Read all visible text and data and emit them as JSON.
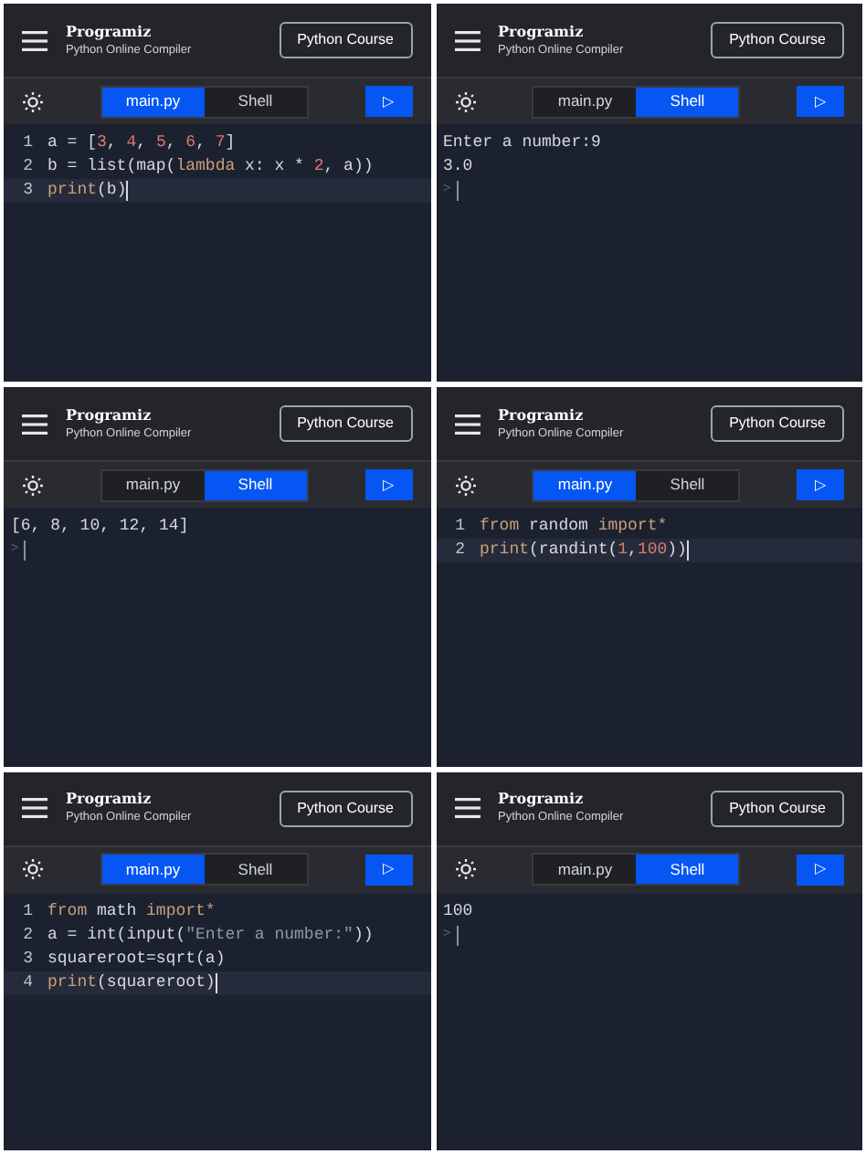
{
  "panels": [
    {
      "header": {
        "logo": "Programiz",
        "subtitle": "Python Online Compiler",
        "course_button": "Python Course"
      },
      "tabs": [
        {
          "label": "main.py",
          "selected": true
        },
        {
          "label": "Shell",
          "selected": false
        }
      ],
      "run_button": "▷",
      "view": {
        "kind": "editor",
        "lines": [
          {
            "number": "1",
            "active": false,
            "tokens": [
              {
                "text": "a = [",
                "kind": "plain"
              },
              {
                "text": "3",
                "kind": "number"
              },
              {
                "text": ", ",
                "kind": "plain"
              },
              {
                "text": "4",
                "kind": "number"
              },
              {
                "text": ", ",
                "kind": "plain"
              },
              {
                "text": "5",
                "kind": "number"
              },
              {
                "text": ", ",
                "kind": "plain"
              },
              {
                "text": "6",
                "kind": "number"
              },
              {
                "text": ", ",
                "kind": "plain"
              },
              {
                "text": "7",
                "kind": "number"
              },
              {
                "text": "]",
                "kind": "plain"
              }
            ]
          },
          {
            "number": "2",
            "active": false,
            "tokens": [
              {
                "text": "b = list(map(",
                "kind": "plain"
              },
              {
                "text": "lambda",
                "kind": "keyword"
              },
              {
                "text": " x: x * ",
                "kind": "plain"
              },
              {
                "text": "2",
                "kind": "number"
              },
              {
                "text": ", a))",
                "kind": "plain"
              }
            ]
          },
          {
            "number": "3",
            "active": true,
            "tokens": [
              {
                "text": "print",
                "kind": "keyword"
              },
              {
                "text": "(b)",
                "kind": "plain"
              }
            ]
          }
        ]
      }
    },
    {
      "header": {
        "logo": "Programiz",
        "subtitle": "Python Online Compiler",
        "course_button": "Python Course"
      },
      "tabs": [
        {
          "label": "main.py",
          "selected": false
        },
        {
          "label": "Shell",
          "selected": true
        }
      ],
      "run_button": "▷",
      "view": {
        "kind": "shell",
        "lines": [
          "Enter a number:9",
          "3.0"
        ],
        "prompt": ">"
      }
    },
    {
      "header": {
        "logo": "Programiz",
        "subtitle": "Python Online Compiler",
        "course_button": "Python Course"
      },
      "tabs": [
        {
          "label": "main.py",
          "selected": false
        },
        {
          "label": "Shell",
          "selected": true
        }
      ],
      "run_button": "▷",
      "view": {
        "kind": "shell",
        "lines": [
          "[6, 8, 10, 12, 14]"
        ],
        "prompt": ">"
      }
    },
    {
      "header": {
        "logo": "Programiz",
        "subtitle": "Python Online Compiler",
        "course_button": "Python Course"
      },
      "tabs": [
        {
          "label": "main.py",
          "selected": true
        },
        {
          "label": "Shell",
          "selected": false
        }
      ],
      "run_button": "▷",
      "view": {
        "kind": "editor",
        "lines": [
          {
            "number": "1",
            "active": false,
            "tokens": [
              {
                "text": "from",
                "kind": "keyword"
              },
              {
                "text": " random ",
                "kind": "plain"
              },
              {
                "text": "import*",
                "kind": "keyword"
              }
            ]
          },
          {
            "number": "2",
            "active": true,
            "tokens": [
              {
                "text": "print",
                "kind": "keyword"
              },
              {
                "text": "(randint(",
                "kind": "plain"
              },
              {
                "text": "1",
                "kind": "number"
              },
              {
                "text": ",",
                "kind": "plain"
              },
              {
                "text": "100",
                "kind": "number"
              },
              {
                "text": "))",
                "kind": "plain"
              }
            ]
          }
        ]
      }
    },
    {
      "header": {
        "logo": "Programiz",
        "subtitle": "Python Online Compiler",
        "course_button": "Python Course"
      },
      "tabs": [
        {
          "label": "main.py",
          "selected": true
        },
        {
          "label": "Shell",
          "selected": false
        }
      ],
      "run_button": "▷",
      "view": {
        "kind": "editor",
        "lines": [
          {
            "number": "1",
            "active": false,
            "tokens": [
              {
                "text": "from",
                "kind": "keyword"
              },
              {
                "text": " math ",
                "kind": "plain"
              },
              {
                "text": "import*",
                "kind": "keyword"
              }
            ]
          },
          {
            "number": "2",
            "active": false,
            "tokens": [
              {
                "text": "a = int(input(",
                "kind": "plain"
              },
              {
                "text": "\"Enter a number:\"",
                "kind": "string"
              },
              {
                "text": "))",
                "kind": "plain"
              }
            ]
          },
          {
            "number": "3",
            "active": false,
            "tokens": [
              {
                "text": "squareroot=sqrt(a)",
                "kind": "plain"
              }
            ]
          },
          {
            "number": "4",
            "active": true,
            "tokens": [
              {
                "text": "print",
                "kind": "keyword"
              },
              {
                "text": "(squareroot)",
                "kind": "plain"
              }
            ]
          }
        ]
      }
    },
    {
      "header": {
        "logo": "Programiz",
        "subtitle": "Python Online Compiler",
        "course_button": "Python Course"
      },
      "tabs": [
        {
          "label": "main.py",
          "selected": false
        },
        {
          "label": "Shell",
          "selected": true
        }
      ],
      "run_button": "▷",
      "view": {
        "kind": "shell",
        "lines": [
          "100"
        ],
        "prompt": ">"
      }
    }
  ]
}
